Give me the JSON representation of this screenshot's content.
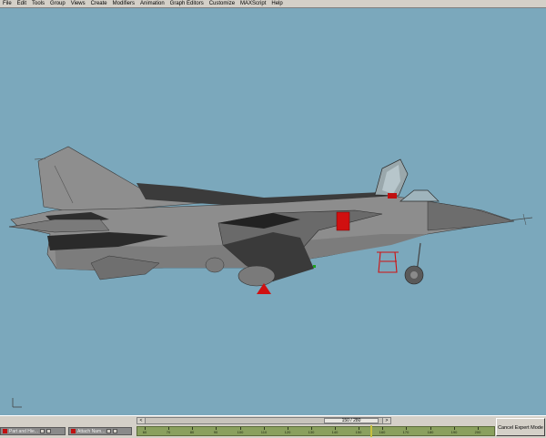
{
  "menu": {
    "items": [
      "File",
      "Edit",
      "Tools",
      "Group",
      "Views",
      "Create",
      "Modifiers",
      "Animation",
      "Graph Editors",
      "Customize",
      "MAXScript",
      "Help"
    ]
  },
  "time_slider": {
    "label": "150 / 280",
    "prev_glyph": "<",
    "next_glyph": ">"
  },
  "trackbar": {
    "ticks": [
      "60",
      "70",
      "80",
      "90",
      "100",
      "110",
      "120",
      "130",
      "140",
      "150",
      "160",
      "170",
      "180",
      "190",
      "200"
    ],
    "cursor_frame": 150
  },
  "taskbar": {
    "items": [
      {
        "label": "Part and Hie..."
      },
      {
        "label": "Attach Nam..."
      }
    ]
  },
  "cancel_expert_label": "Cancel Expert Mode",
  "colors": {
    "viewport_bg": "#7ba8bc",
    "model_gray": "#8c8c8c",
    "model_dark": "#2a2a2a",
    "accent_red": "#d01010"
  },
  "icons": {
    "axis_gizmo": "axis-tripod-icon"
  }
}
